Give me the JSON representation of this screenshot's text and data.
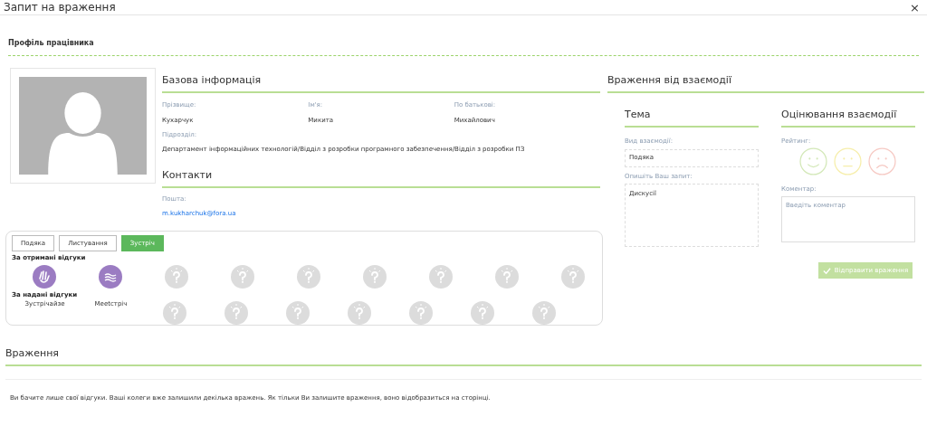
{
  "window": {
    "title": "Запит на враження",
    "close": "×"
  },
  "profile_title": "Профіль працівника",
  "basic": {
    "title": "Базова інформація",
    "fields": [
      {
        "label": "Прізвище:",
        "value": "Кухарчук"
      },
      {
        "label": "Ім'я:",
        "value": "Микита"
      },
      {
        "label": "По батькові:",
        "value": "Михайлович"
      }
    ],
    "department_label": "Підрозділ:",
    "department": "Департамент інформаційних технологій/Відділ з розробки програмного забезпечення/Відділ з розробки ПЗ"
  },
  "contacts": {
    "title": "Контакти",
    "email_label": "Пошта:",
    "email": "m.kukharchuk@fora.ua"
  },
  "tabs": [
    {
      "label": "Подяка",
      "selected": false
    },
    {
      "label": "Листування",
      "selected": false
    },
    {
      "label": "Зустріч",
      "selected": true
    }
  ],
  "received": {
    "title": "За отримані відгуки",
    "badges": [
      {
        "kind": "clap"
      },
      {
        "kind": "waves"
      },
      {
        "kind": "unknown"
      },
      {
        "kind": "unknown"
      },
      {
        "kind": "unknown"
      },
      {
        "kind": "unknown"
      },
      {
        "kind": "unknown"
      },
      {
        "kind": "unknown"
      },
      {
        "kind": "unknown"
      }
    ]
  },
  "given": {
    "title": "За надані відгуки",
    "badges": [
      {
        "kind": "image",
        "alt": "Зустрічайзе"
      },
      {
        "kind": "image",
        "alt": "Meetстріч"
      },
      {
        "kind": "unknown"
      },
      {
        "kind": "unknown"
      },
      {
        "kind": "unknown"
      },
      {
        "kind": "unknown"
      },
      {
        "kind": "unknown"
      },
      {
        "kind": "unknown"
      },
      {
        "kind": "unknown"
      }
    ]
  },
  "interaction": {
    "title": "Враження від взаємодії",
    "topic": {
      "title": "Тема",
      "type_label": "Вид взаємодії:",
      "type_value": "Подяка",
      "request_label": "Опишіть Ваш запит:",
      "request_value": "Дискусії"
    },
    "rating": {
      "title": "Оцінювання взаємодії",
      "label": "Рейтинг:",
      "faces": [
        {
          "kind": "happy",
          "selected": false
        },
        {
          "kind": "neutral",
          "selected": false
        },
        {
          "kind": "sad",
          "selected": false
        }
      ],
      "comment_label": "Коментар:",
      "comment_placeholder": "Введіть коментар"
    },
    "submit": {
      "label": "Відправити враження",
      "disabled": true
    }
  },
  "impressions": {
    "title": "Враження",
    "note": "Ви бачите лише свої відгуки. Ваші колеги вже залишили декілька вражень. Як тільки Ви залишите враження, воно відобразиться на сторінці."
  }
}
